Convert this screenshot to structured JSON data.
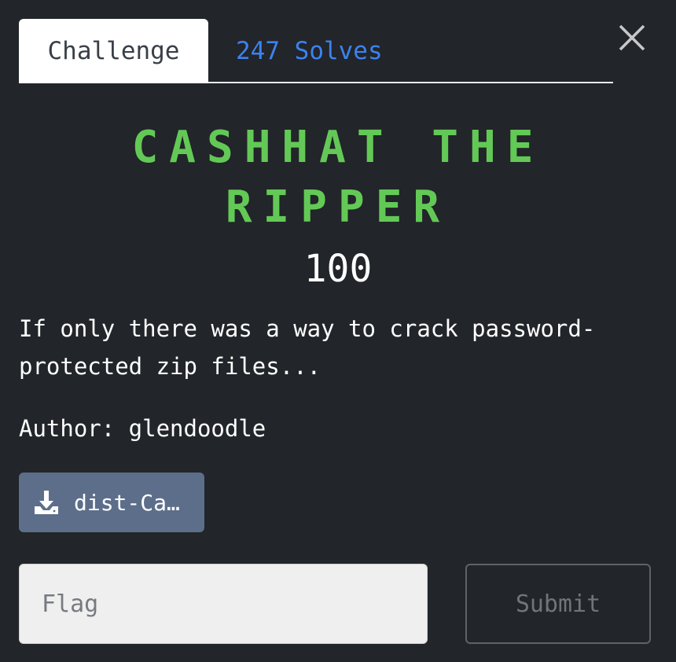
{
  "tabs": {
    "challenge_label": "Challenge",
    "solves_label": "247 Solves"
  },
  "challenge": {
    "title": "CASHHAT THE RIPPER",
    "points": "100",
    "description": "If only there was a way to crack password-protected zip files...",
    "author": "Author: glendoodle"
  },
  "files": {
    "download_label": "dist-Ca…",
    "icon": "download-icon"
  },
  "flag_form": {
    "placeholder": "Flag",
    "value": "",
    "submit_label": "Submit"
  },
  "colors": {
    "background": "#222529",
    "title_green": "#63c956",
    "solves_blue": "#3d82f0",
    "file_button": "#5d6e8a"
  }
}
